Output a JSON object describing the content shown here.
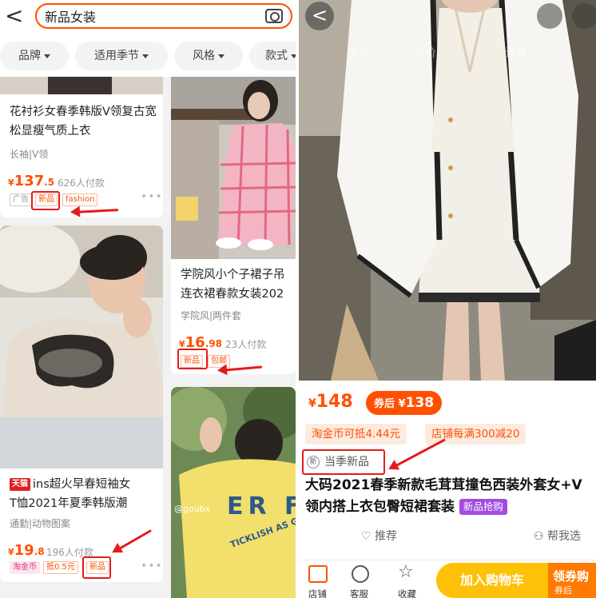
{
  "left": {
    "back_glyph": "<",
    "search": {
      "value": "新品女装"
    },
    "filters": [
      "品牌",
      "适用季节",
      "风格",
      "款式"
    ],
    "products": [
      {
        "title": "花衬衫女春季韩版V领复古宽松显瘦气质上衣",
        "subtitle": "长袖|V领",
        "price_int": "137",
        "price_dec": ".5",
        "paid": "626人付款",
        "tags": [
          "广告",
          "新品",
          "fashion"
        ]
      },
      {
        "title_line1": "学院风小个子裙子吊",
        "title_line2": "连衣裙春款女装202",
        "subtitle": "学院风|两件套",
        "price_int": "16",
        "price_dec": ".98",
        "paid": "23人付款",
        "tags": [
          "新品",
          "包邮"
        ]
      },
      {
        "tmall": "天猫",
        "title_line1": "ins超火早春短袖女",
        "title_line2": "T恤2021年夏季韩版潮",
        "subtitle": "通勤|动物图案",
        "price_int": "19",
        "price_dec": ".8",
        "paid": "196人付款",
        "tags": [
          "淘金币",
          "抵0.5元",
          "新品"
        ]
      },
      {
        "watermark": "@goubx",
        "shirt_text": "ER F",
        "shirt_sub": "TICKLISH AS G"
      }
    ]
  },
  "right": {
    "back_glyph": "<",
    "tabs": [
      "宝贝",
      "评价",
      "详情"
    ],
    "price": {
      "yen": "¥",
      "value": "148"
    },
    "coupon": {
      "label": "券后",
      "yen": "¥",
      "value": "138"
    },
    "promos": [
      "淘金币可抵4.44元",
      "店铺每满300减20"
    ],
    "season": {
      "icon": "新",
      "label": "当季新品"
    },
    "title": "大码2021春季新款毛茸茸撞色西装外套女+V领内搭上衣包臀短裙套装",
    "new_tag": "新品抢购",
    "actions": {
      "recommend": "推荐",
      "share": "帮我选"
    },
    "bottom": {
      "shop": "店铺",
      "service": "客服",
      "fav": "收藏",
      "add_cart": "加入购物车",
      "buy": "领券购",
      "buy_sub": "券后"
    }
  },
  "colors": {
    "accent": "#ff5000",
    "annotation": "#e31b1b",
    "newtag": "#a34be0",
    "cart": "#ffc107"
  }
}
